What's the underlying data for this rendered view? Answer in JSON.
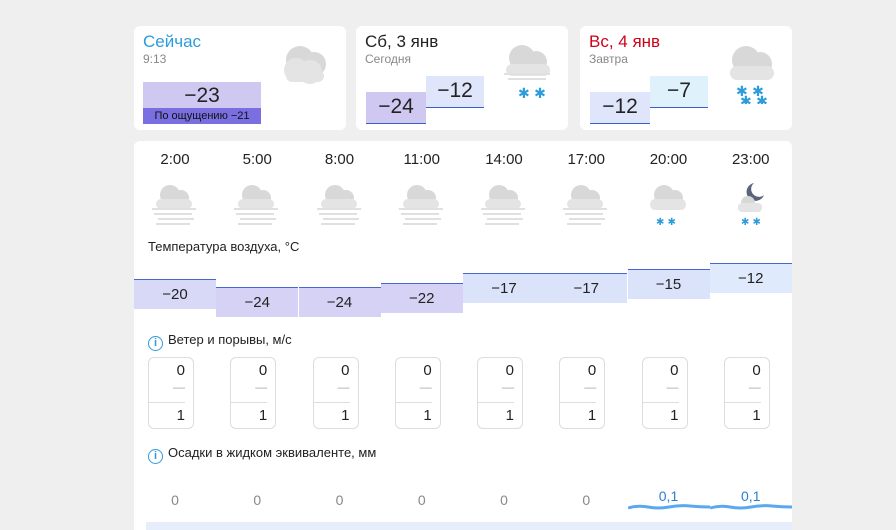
{
  "now": {
    "title": "Сейчас",
    "time": "9:13",
    "temp": "−23",
    "feels": "По ощущению −21",
    "title_color": "#2d9cdb",
    "icon": "cloudy-icon"
  },
  "days": [
    {
      "title": "Сб, 3 янв",
      "sub": "Сегодня",
      "low": "−24",
      "high": "−12",
      "icon": "cloud-snow-icon"
    },
    {
      "title": "Вс, 4 янв",
      "sub": "Завтра",
      "low": "−12",
      "high": "−7",
      "icon": "cloud-snow-icon",
      "title_color": "#d0021b"
    }
  ],
  "hourly": {
    "times": [
      "2:00",
      "5:00",
      "8:00",
      "11:00",
      "14:00",
      "17:00",
      "20:00",
      "23:00"
    ],
    "icons": [
      "fog-cloud-icon",
      "fog-cloud-icon",
      "fog-cloud-icon",
      "fog-cloud-icon",
      "fog-cloud-icon",
      "fog-cloud-icon",
      "cloud-snow-icon",
      "moon-cloud-snow-icon"
    ],
    "temp_label": "Температура воздуха, °C",
    "temps": [
      "−20",
      "−24",
      "−24",
      "−22",
      "−17",
      "−17",
      "−15",
      "−12"
    ],
    "temp_values": [
      -20,
      -24,
      -24,
      -22,
      -17,
      -17,
      -15,
      -12
    ],
    "wind_label": "Ветер и порывы, м/с",
    "wind": [
      "0",
      "0",
      "0",
      "0",
      "0",
      "0",
      "0",
      "0"
    ],
    "wind_dash": "—",
    "gusts": [
      "1",
      "1",
      "1",
      "1",
      "1",
      "1",
      "1",
      "1"
    ],
    "precip_label": "Осадки в жидком эквиваленте, мм",
    "precip": [
      "0",
      "0",
      "0",
      "0",
      "0",
      "0",
      "0,1",
      "0,1"
    ]
  },
  "info_glyph": "i"
}
